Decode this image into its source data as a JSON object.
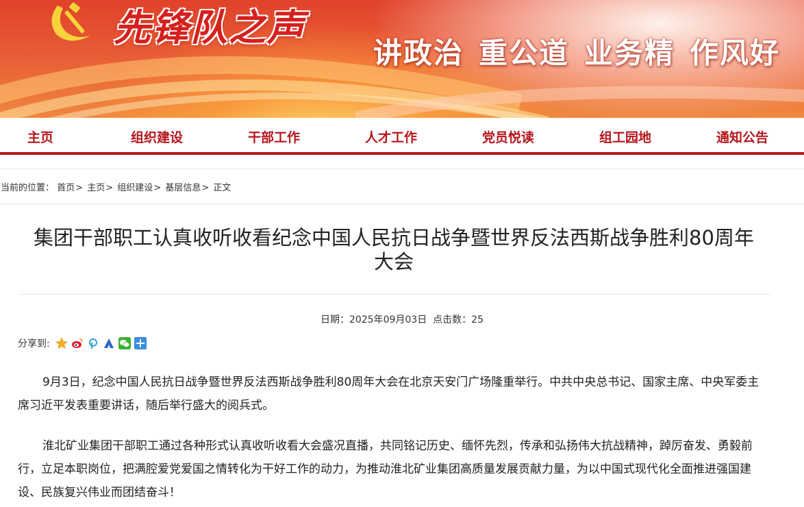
{
  "banner": {
    "brand_title": "先锋队之声",
    "slogans": [
      "讲政治",
      "重公道",
      "业务精",
      "作风好"
    ],
    "emblem_icon": "hammer-sickle-emblem-icon"
  },
  "nav": {
    "items": [
      {
        "label": "主页"
      },
      {
        "label": "组织建设"
      },
      {
        "label": "干部工作"
      },
      {
        "label": "人才工作"
      },
      {
        "label": "党员悦读"
      },
      {
        "label": "组工园地"
      },
      {
        "label": "通知公告"
      }
    ]
  },
  "breadcrumb": {
    "prefix": "您当前的位置：",
    "items": [
      "首页",
      "主页",
      "组织建设",
      "基层信息",
      "正文"
    ],
    "separator": ">"
  },
  "article": {
    "title": "集团干部职工认真收听收看纪念中国人民抗日战争暨世界反法西斯战争胜利80周年大会",
    "date_label": "日期：",
    "date": "2025年09月03日",
    "views_label": "点击数：",
    "views": "25",
    "share_label": "分享到:",
    "share_icons": [
      "qzone-star-icon",
      "weibo-icon",
      "pengyou-icon",
      "baidu-icon",
      "wechat-icon",
      "more-plus-icon"
    ],
    "paragraphs": [
      "9月3日，纪念中国人民抗日战争暨世界反法西斯战争胜利80周年大会在北京天安门广场隆重举行。中共中央总书记、国家主席、中央军委主席习近平发表重要讲话，随后举行盛大的阅兵式。",
      "淮北矿业集团干部职工通过各种形式认真收听收看大会盛况直播，共同铭记历史、缅怀先烈，传承和弘扬伟大抗战精神，踔厉奋发、勇毅前行，立足本职岗位，把满腔爱党爱国之情转化为干好工作的动力，为推动淮北矿业集团高质量发展贡献力量，为以中国式现代化全面推进强国建设、民族复兴伟业而团结奋斗！"
    ]
  },
  "colors": {
    "party_red": "#b5161c",
    "banner_orange": "#f0873e",
    "brand_red": "#d6201e"
  }
}
